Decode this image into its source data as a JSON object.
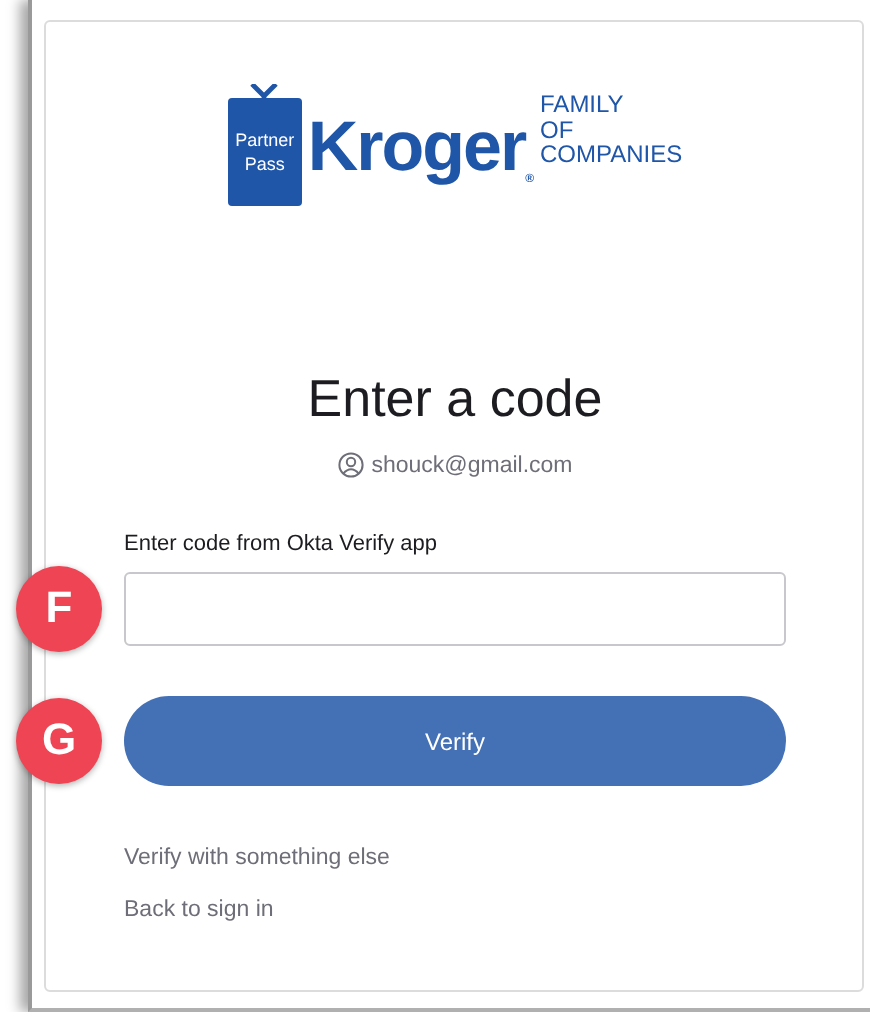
{
  "logo": {
    "badge_lines": [
      "Partner",
      "Pass"
    ],
    "wordmark": "Kroger",
    "registered": "®",
    "tagline_lines": [
      "FAMILY",
      "OF",
      "COMPANIES"
    ]
  },
  "title": "Enter a code",
  "account": "shouck@gmail.com",
  "field": {
    "label": "Enter code from Okta Verify app",
    "marker": "F"
  },
  "button": {
    "label": "Verify",
    "marker": "G"
  },
  "links": [
    "Verify with something else",
    "Back to sign in"
  ]
}
